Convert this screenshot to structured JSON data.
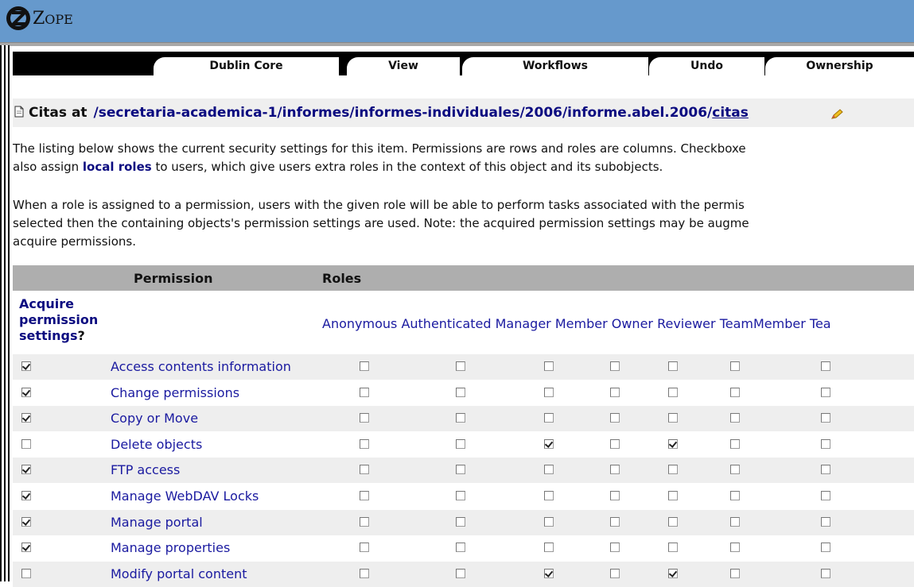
{
  "app": {
    "logo_text_big": "Z",
    "logo_text_small": "OPE"
  },
  "tabs": [
    "Dublin Core",
    "View",
    "Workflows",
    "Undo",
    "Ownership"
  ],
  "header": {
    "prefix": "Citas at",
    "path": "/secretaria-academica-1/informes/informes-individuales/2006/informe.abel.2006/",
    "current": "citas"
  },
  "intro": {
    "line1": "The listing below shows the current security settings for this item. Permissions are rows and roles are columns. Checkboxe",
    "line2_pre": "also assign ",
    "line2_link": "local roles",
    "line2_post": " to users, which give users extra roles in the context of this object and its subobjects.",
    "line3": "When a role is assigned to a permission, users with the given role will be able to perform tasks associated with the permis",
    "line4": "selected then the containing objects's permission settings are used. Note: the acquired permission settings may be augme",
    "line5": "acquire permissions."
  },
  "table": {
    "col_permission": "Permission",
    "col_roles": "Roles",
    "acquire_line1": "Acquire",
    "acquire_line2": "permission",
    "acquire_line3": "settings",
    "acquire_q": "?",
    "roles": [
      "Anonymous",
      "Authenticated",
      "Manager",
      "Member",
      "Owner",
      "Reviewer",
      "TeamMember",
      "Tea"
    ],
    "rows": [
      {
        "name": "Access contents information",
        "acquire": true,
        "checks": [
          false,
          false,
          false,
          false,
          false,
          false,
          false
        ]
      },
      {
        "name": "Change permissions",
        "acquire": true,
        "checks": [
          false,
          false,
          false,
          false,
          false,
          false,
          false
        ]
      },
      {
        "name": "Copy or Move",
        "acquire": true,
        "checks": [
          false,
          false,
          false,
          false,
          false,
          false,
          false
        ]
      },
      {
        "name": "Delete objects",
        "acquire": false,
        "checks": [
          false,
          false,
          true,
          false,
          true,
          false,
          false
        ]
      },
      {
        "name": "FTP access",
        "acquire": true,
        "checks": [
          false,
          false,
          false,
          false,
          false,
          false,
          false
        ]
      },
      {
        "name": "Manage WebDAV Locks",
        "acquire": true,
        "checks": [
          false,
          false,
          false,
          false,
          false,
          false,
          false
        ]
      },
      {
        "name": "Manage portal",
        "acquire": true,
        "checks": [
          false,
          false,
          false,
          false,
          false,
          false,
          false
        ]
      },
      {
        "name": "Manage properties",
        "acquire": true,
        "checks": [
          false,
          false,
          false,
          false,
          false,
          false,
          false
        ]
      },
      {
        "name": "Modify portal content",
        "acquire": false,
        "checks": [
          false,
          false,
          true,
          false,
          true,
          false,
          false
        ]
      }
    ]
  },
  "colors": {
    "topbar": "#6699cc",
    "link": "#1a1aa0",
    "dark_link": "#0b0b80"
  }
}
